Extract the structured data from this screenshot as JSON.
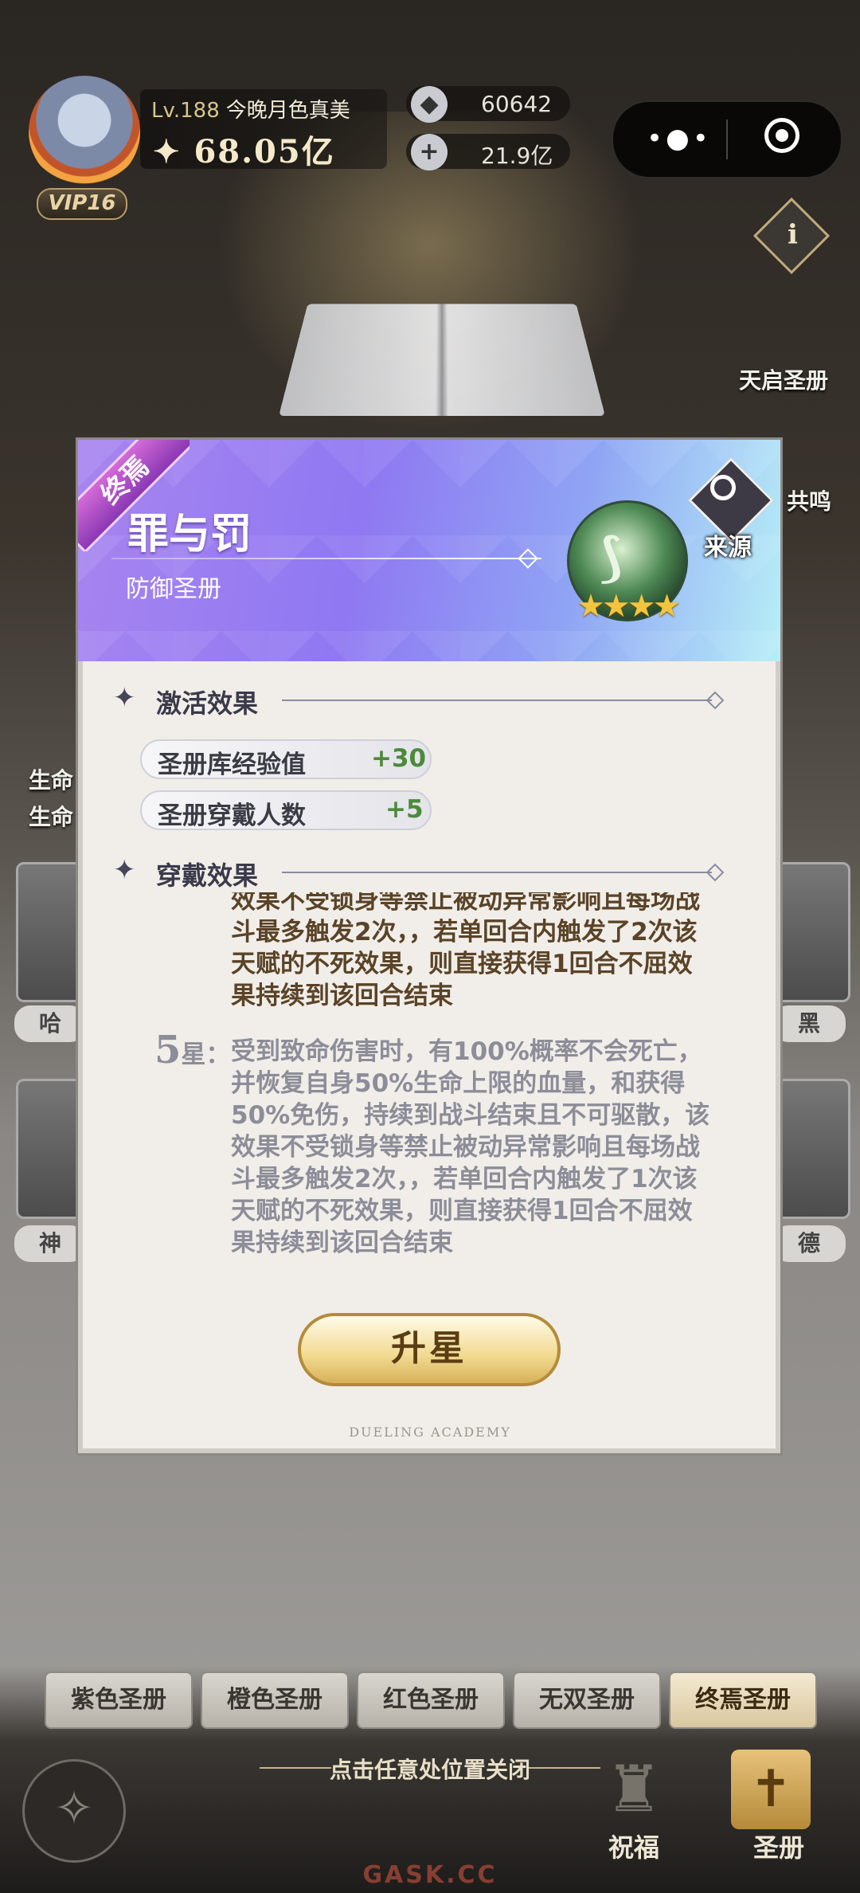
{
  "player": {
    "level_prefix": "Lv.",
    "level": "188",
    "name": "今晚月色真美",
    "power": "68.05亿",
    "vip": "VIP16"
  },
  "currencies": [
    {
      "icon": "diamond-icon",
      "value": "60642"
    },
    {
      "icon": "coin-icon",
      "value": "21.9亿"
    }
  ],
  "side": {
    "tianqi": "天启圣册",
    "gongming": "共鸣",
    "left_labels": [
      "生命",
      "生命"
    ],
    "left_cards": [
      "哈",
      "神"
    ],
    "right_cards": [
      "黑",
      "德"
    ]
  },
  "dialog": {
    "badge": "终焉",
    "title": "罪与罚",
    "subtitle": "防御圣册",
    "emblem_stars": "★★★★",
    "source_label": "来源",
    "activation": {
      "title": "激活效果",
      "stats": [
        {
          "label": "圣册库经验值",
          "value": "+30"
        },
        {
          "label": "圣册穿戴人数",
          "value": "+5"
        }
      ]
    },
    "wear": {
      "title": "穿戴效果",
      "active_lines": [
        "效果不受锁身等禁止被动异常影响且每场战",
        "斗最多触发2次，，若单回合内触发了2次该",
        "天赋的不死效果，则直接获得1回合不屈效",
        "果持续到该回合结束"
      ],
      "tier": {
        "num": "5",
        "star": "星：",
        "lines": [
          "受到致命伤害时，有100%概率不会死亡，",
          "并恢复自身50%生命上限的血量，和获得",
          "50%免伤，持续到战斗结束且不可驱散，该",
          "效果不受锁身等禁止被动异常影响且每场战",
          "斗最多触发2次，，若单回合内触发了1次该",
          "天赋的不死效果，则直接获得1回合不屈效",
          "果持续到该回合结束"
        ]
      }
    },
    "upgrade_label": "升星",
    "footer": "DUELING ACADEMY"
  },
  "tabs": [
    {
      "label": "紫色圣册",
      "active": false
    },
    {
      "label": "橙色圣册",
      "active": false
    },
    {
      "label": "红色圣册",
      "active": false
    },
    {
      "label": "无双圣册",
      "active": false
    },
    {
      "label": "终焉圣册",
      "active": true
    }
  ],
  "hint": "点击任意处位置关闭",
  "bottom_nav": {
    "blessing": "祝福",
    "holy_book": "圣册"
  },
  "watermark": "GASK.CC",
  "colors": {
    "banner_start": "#a885f0",
    "banner_end": "#b7eef7",
    "active_text": "#5a4327",
    "inactive_text": "#8c8d98",
    "stat_value": "#4c8a3a"
  }
}
